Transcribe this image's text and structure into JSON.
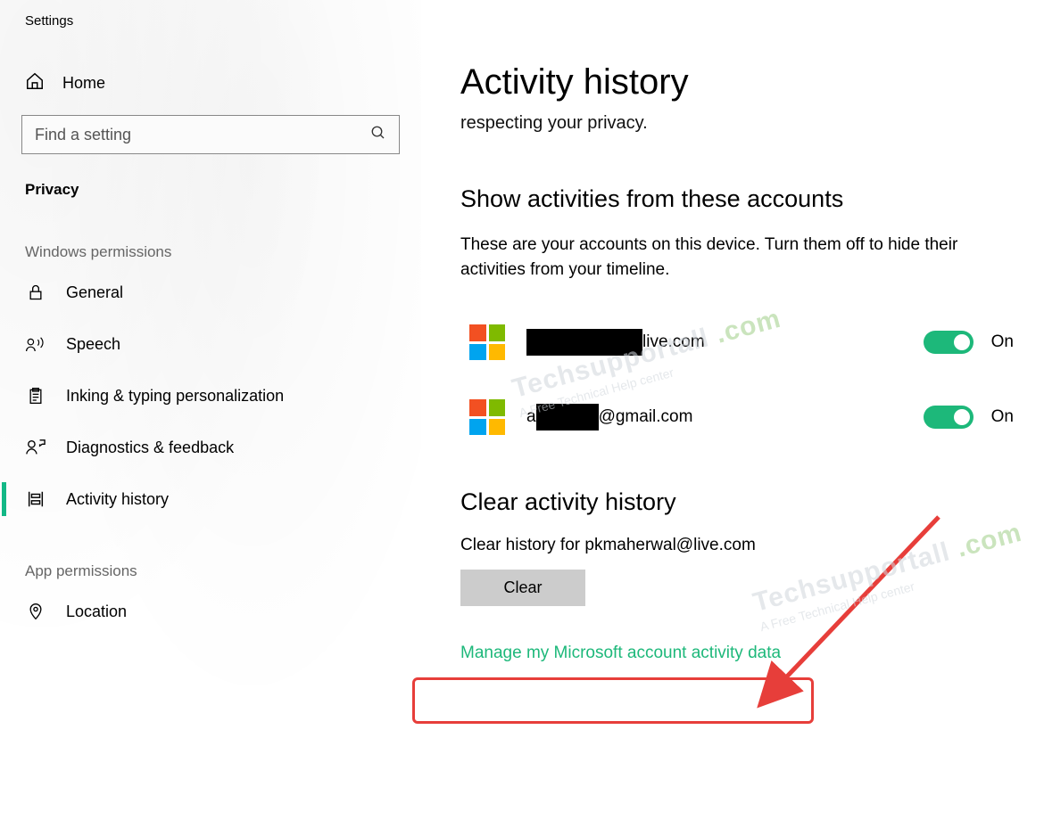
{
  "app_title": "Settings",
  "home_label": "Home",
  "search_placeholder": "Find a setting",
  "category": "Privacy",
  "groups": {
    "windows": "Windows permissions",
    "app": "App permissions"
  },
  "nav": {
    "general": "General",
    "speech": "Speech",
    "inking": "Inking & typing personalization",
    "diagnostics": "Diagnostics & feedback",
    "activity": "Activity history",
    "location": "Location"
  },
  "page": {
    "title": "Activity history",
    "subtitle": "respecting your privacy.",
    "accounts_heading": "Show activities from these accounts",
    "accounts_desc": "These are your accounts on this device. Turn them off to hide their activities from your timeline.",
    "accounts": [
      {
        "email_suffix": "live.com",
        "toggle": "On"
      },
      {
        "email_prefix": "a",
        "email_suffix": "@gmail.com",
        "toggle": "On"
      }
    ],
    "clear_heading": "Clear activity history",
    "clear_desc": "Clear history for pkmaherwal@live.com",
    "clear_button": "Clear",
    "manage_link": "Manage my Microsoft account activity data"
  },
  "watermark": {
    "line1": "Techsupportall",
    "line2": "A Free Technical Help center",
    "suffix": ".com"
  }
}
